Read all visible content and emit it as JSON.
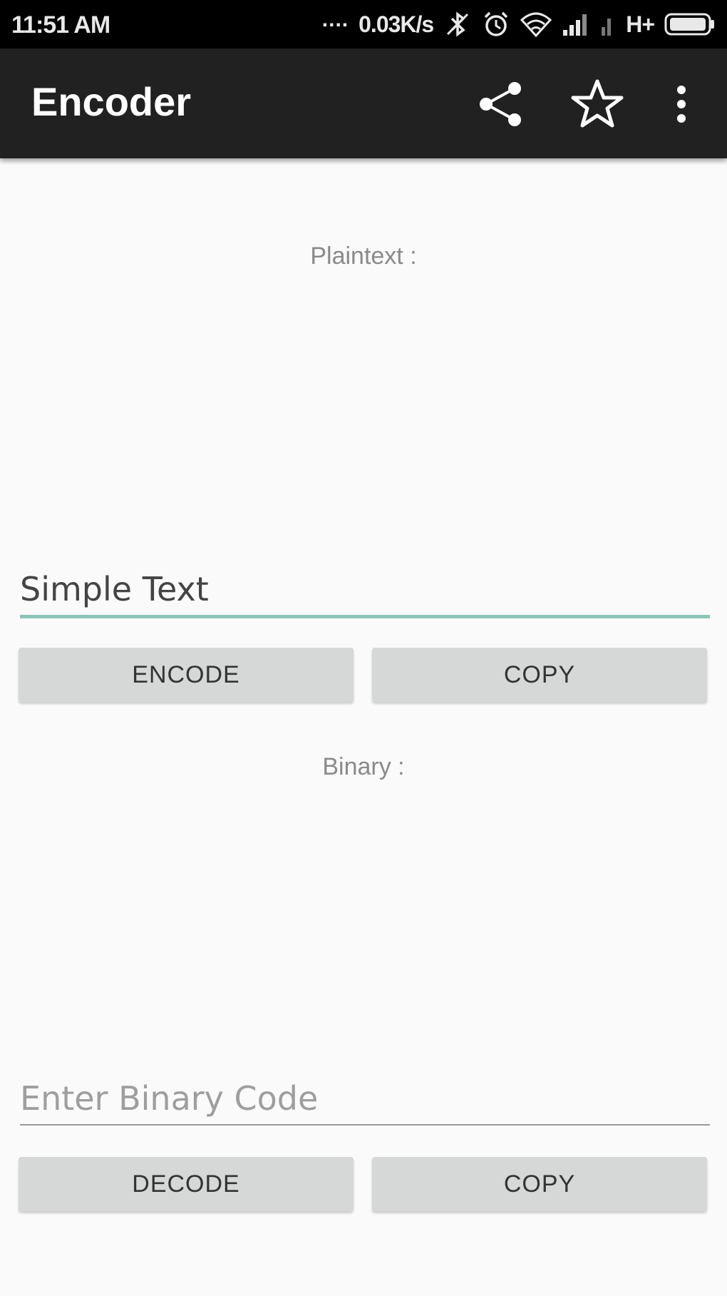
{
  "status_bar": {
    "time": "11:51 AM",
    "notification_dots": "....",
    "network_speed": "0.03K/s",
    "icons": [
      "bluetooth-off-icon",
      "alarm-icon",
      "wifi-icon",
      "signal-icon",
      "signal-secondary-icon",
      "hplus-icon",
      "battery-icon"
    ],
    "network_type": "H+"
  },
  "app_bar": {
    "title": "Encoder",
    "actions": [
      "share-icon",
      "star-outline-icon",
      "overflow-menu-icon"
    ]
  },
  "encode_section": {
    "label": "Plaintext :",
    "input_value": "Simple Text",
    "encode_label": "ENCODE",
    "copy_label": "COPY"
  },
  "decode_section": {
    "label": "Binary :",
    "input_value": "",
    "input_placeholder": "Enter Binary Code",
    "decode_label": "DECODE",
    "copy_label": "COPY"
  },
  "colors": {
    "status_bar_bg": "#000000",
    "app_bar_bg": "#212121",
    "background": "#fafafa",
    "accent_underline": "#8cc4b8",
    "button_bg": "#d6d7d7"
  }
}
